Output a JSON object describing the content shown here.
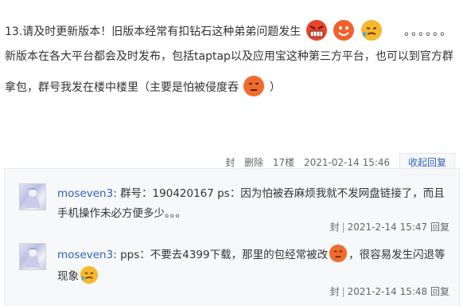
{
  "post": {
    "line1": "13.请及时更新版本！旧版本经常有扣钻石这种弟弟问题发生",
    "line1_dots": "。。。。。。",
    "line2": "新版本在各大平台都会及时发布，包括taptap以及应用宝这种第三方平台，也可以到官方群",
    "line3_a": "拿包，群号我发在楼中楼里（主要是怕被侵度吞",
    "line3_b": "）",
    "meta": {
      "seal": "封",
      "delete": "删除",
      "floor": "17楼",
      "date": "2021-02-14 15:46",
      "collapse": "收起回复"
    }
  },
  "replies": [
    {
      "user": "moseven3",
      "colon": ":",
      "text": "群号：190420167 ps：因为怕被吞麻烦我就不发网盘链接了，而且手机操作未必方便多少。。。",
      "seal": "封",
      "sep": "|",
      "date": "2021-2-14 15:47",
      "reply": "回复"
    },
    {
      "user": "moseven3",
      "colon": ":",
      "text_a": "pps：不要去4399下载，那里的包经常被改",
      "text_b": "，很容易发生闪退等现象",
      "seal": "封",
      "sep": "|",
      "date": "2021-2-14 15:48",
      "reply": "回复"
    }
  ],
  "icons": [
    "angry-emoji-icon",
    "grin-emoji-icon",
    "sweat-emoji-icon",
    "annoyed-emoji-icon",
    "avatar-image"
  ]
}
